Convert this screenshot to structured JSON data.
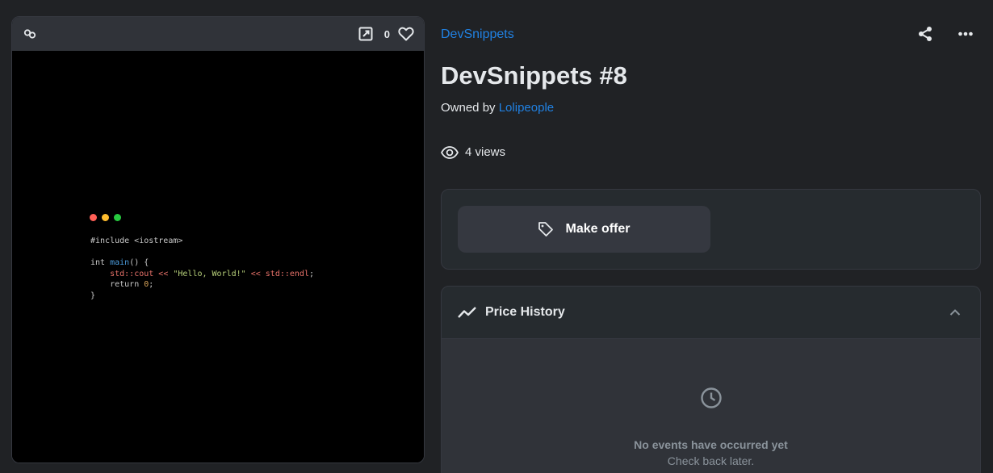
{
  "media": {
    "favorite_count": "0",
    "dot_colors": [
      "#ff5f56",
      "#ffbd2e",
      "#27c93f"
    ],
    "code": {
      "include_line": "#include <iostream>",
      "main_kw": "int ",
      "main_fn": "main",
      "main_rest": "() {",
      "cout_ns": "std::cout",
      "cout_op1": " << ",
      "cout_str": "\"Hello, World!\"",
      "cout_op2": " << ",
      "cout_endl": "std::endl",
      "cout_end": ";",
      "return_kw": "return ",
      "return_num": "0",
      "return_end": ";",
      "close": "}"
    }
  },
  "item": {
    "collection": "DevSnippets",
    "title": "DevSnippets #8",
    "owned_prefix": "Owned by ",
    "owner": "Lolipeople",
    "views": "4 views"
  },
  "offer": {
    "label": "Make offer"
  },
  "price_history": {
    "title": "Price History",
    "empty_title": "No events have occurred yet",
    "empty_sub": "Check back later."
  },
  "icons": [
    "link-icon",
    "external-link-icon",
    "heart-icon",
    "share-icon",
    "more-icon",
    "eye-icon",
    "tag-icon",
    "trending-icon",
    "chevron-up-icon",
    "clock-icon"
  ]
}
